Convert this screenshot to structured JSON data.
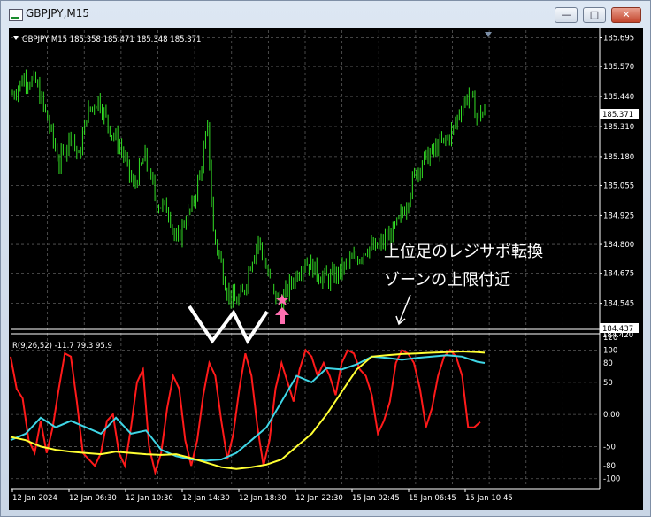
{
  "window": {
    "title": "GBPJPY,M15",
    "min_glyph": "—",
    "max_glyph": "□",
    "close_glyph": "✕"
  },
  "colors": {
    "background": "#000000",
    "grid": "#5a5a5a",
    "candle": "#33e025",
    "cyan_line": "#3fd6e6",
    "yellow_line": "#ffff33",
    "red_line": "#ff1a1a",
    "annotation": "#ffffff",
    "marker": "#ff6fb0"
  },
  "main": {
    "header": "GBPJPY,M15  185.358 185.471 185.348 185.371",
    "annotation_line1": "上位足のレジサポ転換",
    "annotation_line2": "ゾーンの上限付近",
    "current_price_label": "185.371",
    "level_label": "184.437",
    "level_label_behind": "184.420"
  },
  "sub": {
    "header": "R(9,26,52) -11.7 79.3 95.9"
  },
  "chart_data": [
    {
      "type": "candlestick",
      "title": "GBPJPY,M15",
      "ylim": [
        184.44,
        185.72
      ],
      "y_ticks": [
        184.545,
        184.675,
        184.8,
        184.925,
        185.055,
        185.18,
        185.31,
        185.44,
        185.57,
        185.695
      ],
      "x_tick_labels": [
        "12 Jan 2024",
        "12 Jan 06:30",
        "12 Jan 10:30",
        "12 Jan 14:30",
        "12 Jan 18:30",
        "12 Jan 22:30",
        "15 Jan 02:45",
        "15 Jan 06:45",
        "15 Jan 10:45"
      ],
      "last": {
        "open": 185.358,
        "high": 185.471,
        "low": 185.348,
        "close": 185.371
      },
      "horizontal_line": 184.437,
      "close_path": [
        [
          0,
          185.45
        ],
        [
          6,
          185.52
        ],
        [
          12,
          185.5
        ],
        [
          18,
          185.34
        ],
        [
          24,
          185.15
        ],
        [
          30,
          185.28
        ],
        [
          34,
          185.17
        ],
        [
          38,
          185.36
        ],
        [
          44,
          185.43
        ],
        [
          50,
          185.3
        ],
        [
          56,
          185.21
        ],
        [
          62,
          185.05
        ],
        [
          68,
          185.18
        ],
        [
          74,
          184.98
        ],
        [
          80,
          184.95
        ],
        [
          84,
          184.8
        ],
        [
          88,
          184.9
        ],
        [
          92,
          184.96
        ],
        [
          96,
          185.1
        ],
        [
          100,
          185.3
        ],
        [
          103,
          184.85
        ],
        [
          106,
          184.75
        ],
        [
          110,
          184.6
        ],
        [
          114,
          184.55
        ],
        [
          118,
          184.58
        ],
        [
          122,
          184.72
        ],
        [
          126,
          184.82
        ],
        [
          130,
          184.7
        ],
        [
          134,
          184.58
        ],
        [
          138,
          184.55
        ],
        [
          142,
          184.62
        ],
        [
          146,
          184.68
        ],
        [
          150,
          184.73
        ],
        [
          154,
          184.7
        ],
        [
          158,
          184.66
        ],
        [
          162,
          184.65
        ],
        [
          166,
          184.67
        ],
        [
          170,
          184.7
        ],
        [
          174,
          184.73
        ],
        [
          178,
          184.75
        ],
        [
          182,
          184.79
        ],
        [
          186,
          184.78
        ],
        [
          190,
          184.81
        ],
        [
          194,
          184.84
        ],
        [
          198,
          184.9
        ],
        [
          202,
          184.98
        ],
        [
          206,
          185.1
        ],
        [
          210,
          185.16
        ],
        [
          214,
          185.19
        ],
        [
          218,
          185.22
        ],
        [
          222,
          185.25
        ],
        [
          226,
          185.3
        ],
        [
          230,
          185.4
        ],
        [
          234,
          185.45
        ],
        [
          238,
          185.36
        ],
        [
          242,
          185.37
        ]
      ]
    },
    {
      "type": "line",
      "title": "R(9,26,52)",
      "ylim": [
        -110,
        120
      ],
      "y_ticks": [
        120,
        100,
        80,
        50,
        0.0,
        -50,
        -80,
        -100
      ],
      "values_shown": [
        -11.7,
        79.3,
        95.9
      ],
      "series": [
        {
          "color": "#ff1a1a",
          "points": [
            [
              0,
              90
            ],
            [
              4,
              40
            ],
            [
              8,
              25
            ],
            [
              12,
              -40
            ],
            [
              16,
              -60
            ],
            [
              20,
              -10
            ],
            [
              24,
              -60
            ],
            [
              28,
              -20
            ],
            [
              32,
              40
            ],
            [
              36,
              95
            ],
            [
              40,
              90
            ],
            [
              44,
              20
            ],
            [
              48,
              -60
            ],
            [
              52,
              -70
            ],
            [
              56,
              -80
            ],
            [
              60,
              -60
            ],
            [
              64,
              -10
            ],
            [
              68,
              0
            ],
            [
              72,
              -60
            ],
            [
              76,
              -80
            ],
            [
              80,
              -20
            ],
            [
              84,
              50
            ],
            [
              88,
              70
            ],
            [
              92,
              -50
            ],
            [
              96,
              -90
            ],
            [
              100,
              -60
            ],
            [
              104,
              10
            ],
            [
              108,
              60
            ],
            [
              112,
              40
            ],
            [
              116,
              -40
            ],
            [
              120,
              -80
            ],
            [
              124,
              -40
            ],
            [
              128,
              30
            ],
            [
              132,
              80
            ],
            [
              136,
              60
            ],
            [
              140,
              -10
            ],
            [
              144,
              -70
            ],
            [
              148,
              -30
            ],
            [
              152,
              40
            ],
            [
              156,
              95
            ],
            [
              160,
              60
            ],
            [
              164,
              -20
            ],
            [
              168,
              -80
            ],
            [
              172,
              -40
            ],
            [
              176,
              40
            ],
            [
              180,
              80
            ],
            [
              184,
              50
            ],
            [
              188,
              20
            ],
            [
              192,
              70
            ],
            [
              196,
              100
            ],
            [
              200,
              90
            ],
            [
              204,
              60
            ],
            [
              208,
              80
            ],
            [
              212,
              60
            ],
            [
              216,
              30
            ],
            [
              220,
              80
            ],
            [
              224,
              100
            ],
            [
              228,
              95
            ],
            [
              232,
              70
            ],
            [
              236,
              60
            ],
            [
              240,
              30
            ],
            [
              244,
              -30
            ],
            [
              248,
              -10
            ],
            [
              252,
              20
            ],
            [
              256,
              80
            ],
            [
              260,
              100
            ],
            [
              264,
              95
            ],
            [
              268,
              80
            ],
            [
              272,
              40
            ],
            [
              276,
              -20
            ],
            [
              280,
              10
            ],
            [
              284,
              60
            ],
            [
              288,
              90
            ],
            [
              292,
              100
            ],
            [
              296,
              90
            ],
            [
              300,
              60
            ],
            [
              304,
              -20
            ],
            [
              308,
              -20
            ],
            [
              312,
              -12
            ]
          ]
        },
        {
          "color": "#3fd6e6",
          "points": [
            [
              0,
              -40
            ],
            [
              10,
              -30
            ],
            [
              20,
              -5
            ],
            [
              30,
              -20
            ],
            [
              40,
              -10
            ],
            [
              50,
              -20
            ],
            [
              60,
              -30
            ],
            [
              70,
              -5
            ],
            [
              80,
              -30
            ],
            [
              90,
              -25
            ],
            [
              100,
              -55
            ],
            [
              110,
              -65
            ],
            [
              120,
              -70
            ],
            [
              130,
              -72
            ],
            [
              140,
              -70
            ],
            [
              150,
              -60
            ],
            [
              160,
              -40
            ],
            [
              170,
              -20
            ],
            [
              180,
              20
            ],
            [
              190,
              60
            ],
            [
              200,
              50
            ],
            [
              210,
              72
            ],
            [
              220,
              70
            ],
            [
              230,
              78
            ],
            [
              240,
              90
            ],
            [
              250,
              88
            ],
            [
              260,
              85
            ],
            [
              270,
              88
            ],
            [
              280,
              90
            ],
            [
              290,
              92
            ],
            [
              300,
              90
            ],
            [
              310,
              82
            ],
            [
              315,
              80
            ]
          ]
        },
        {
          "color": "#ffff33",
          "points": [
            [
              0,
              -35
            ],
            [
              10,
              -40
            ],
            [
              20,
              -50
            ],
            [
              30,
              -55
            ],
            [
              40,
              -58
            ],
            [
              50,
              -60
            ],
            [
              60,
              -62
            ],
            [
              70,
              -58
            ],
            [
              80,
              -60
            ],
            [
              90,
              -62
            ],
            [
              100,
              -63
            ],
            [
              110,
              -62
            ],
            [
              120,
              -68
            ],
            [
              130,
              -75
            ],
            [
              140,
              -82
            ],
            [
              150,
              -85
            ],
            [
              160,
              -82
            ],
            [
              170,
              -78
            ],
            [
              180,
              -70
            ],
            [
              190,
              -50
            ],
            [
              200,
              -30
            ],
            [
              210,
              0
            ],
            [
              220,
              35
            ],
            [
              230,
              70
            ],
            [
              240,
              90
            ],
            [
              250,
              92
            ],
            [
              260,
              94
            ],
            [
              270,
              95
            ],
            [
              280,
              96
            ],
            [
              290,
              97
            ],
            [
              300,
              98
            ],
            [
              310,
              97
            ],
            [
              315,
              96
            ]
          ]
        }
      ]
    }
  ]
}
